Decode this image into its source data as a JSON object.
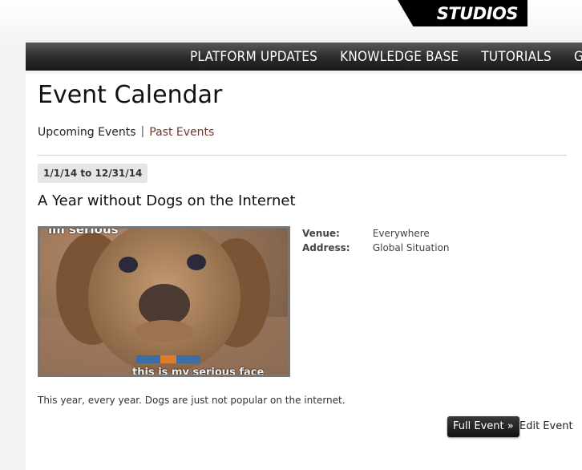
{
  "header": {
    "logo_text": "STUDIOS"
  },
  "nav": {
    "items": [
      {
        "label": "PLATFORM UPDATES"
      },
      {
        "label": "KNOWLEDGE BASE"
      },
      {
        "label": "TUTORIALS"
      },
      {
        "label": "GO"
      }
    ]
  },
  "page": {
    "title": "Event Calendar",
    "tabs": [
      {
        "label": "Upcoming Events"
      },
      {
        "label": "Past Events"
      }
    ]
  },
  "event": {
    "date_range": "1/1/14 to 12/31/14",
    "title": "A Year without Dogs on the Internet",
    "image_caption_top": "im serious",
    "image_caption_bottom": "this is my serious face",
    "venue_label": "Venue:",
    "venue": "Everywhere",
    "address_label": "Address:",
    "address": "Global Situation",
    "description": "This year, every year.  Dogs are just not popular on the internet.",
    "full_event_label": "Full Event »",
    "edit_event_label": "Edit Event"
  },
  "colors": {
    "nav_bg": "#2d2d2d",
    "link_color": "#6b3a2e",
    "badge_bg": "#e6e6e6"
  }
}
